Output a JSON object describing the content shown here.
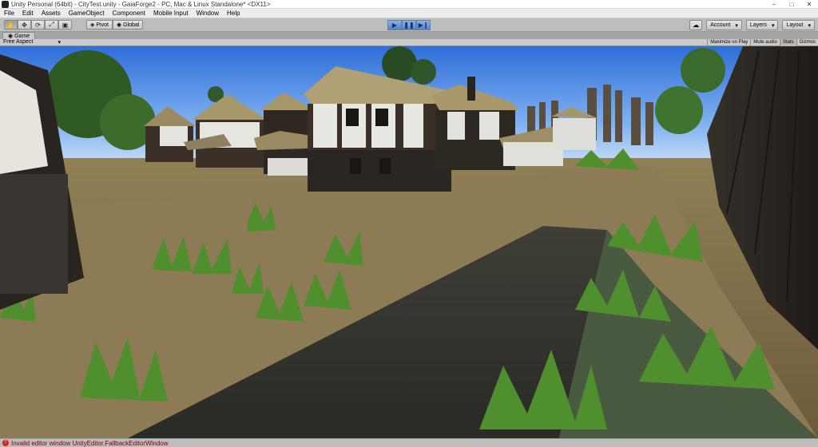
{
  "window": {
    "title": "Unity Personal (64bit) - CityTest.unity - GaiaForge2 - PC, Mac & Linux Standalone* <DX11>"
  },
  "menu": [
    "File",
    "Edit",
    "Assets",
    "GameObject",
    "Component",
    "Mobile Input",
    "Window",
    "Help"
  ],
  "toolbar": {
    "pivot_label": "Pivot",
    "global_label": "Global",
    "account_label": "Account",
    "layers_label": "Layers",
    "layout_label": "Layout"
  },
  "game_view": {
    "tab_label": "Game",
    "aspect_label": "Free Aspect",
    "options": [
      "Maximize on Play",
      "Mute audio",
      "Stats",
      "Gizmos"
    ]
  },
  "status": {
    "message": "Invalid editor window UnityEditor.FallbackEditorWindow"
  },
  "colors": {
    "play_accent": "#4f82c9",
    "error": "#d32222"
  }
}
